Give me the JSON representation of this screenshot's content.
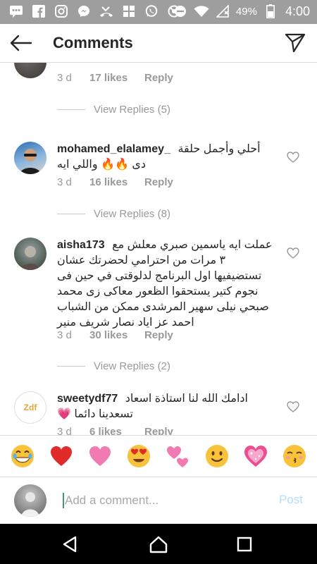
{
  "status_bar": {
    "battery_percent": "49%",
    "time": "4:00",
    "left_icons": [
      "messages-icon",
      "facebook-icon",
      "instagram-icon",
      "messenger-icon",
      "missed-call-icon",
      "gallery-icon",
      "whatsapp-icon",
      "blocked-icon"
    ],
    "right_icons": [
      "do-not-disturb-icon",
      "wifi-icon",
      "signal-icon",
      "battery-icon"
    ]
  },
  "header": {
    "title": "Comments"
  },
  "comments": [
    {
      "emoji_text": "👏🏻👏🏻👏🏻",
      "time": "3 d",
      "likes": "17 likes",
      "reply": "Reply",
      "view_replies": "View Replies (5)"
    },
    {
      "username": "mohamed_elalamey_",
      "text": "أحلي وأجمل حلقة دى 🔥🔥 واللي ايه",
      "time": "3 d",
      "likes": "16 likes",
      "reply": "Reply",
      "view_replies": "View Replies (8)"
    },
    {
      "username": "aisha173",
      "text": "عملت ايه ياسمين صبري معلش مع ٣ مرات من احترامي لحضرتك عشان تستضيفيها اول البرنامج لدلوقتى في حين فى نجوم كتير يستحقوا الظعور معاكى زى محمد صبحي نيلى سهير المرشدى ممكن من الشباب احمد عز اياد نصار شريف منير",
      "time": "3 d",
      "likes": "30 likes",
      "reply": "Reply",
      "view_replies": "View Replies (2)"
    },
    {
      "username": "sweetydf77",
      "avatar_text": "Zdf",
      "text": "ادامك الله لنا استاذة اسعاد تسعدينا دائما 💗",
      "time": "3 d",
      "likes": "6 likes",
      "reply": "Reply"
    }
  ],
  "emoji_bar": [
    "😂",
    "❤️",
    "💗",
    "😍",
    "💕",
    "🙂",
    "💖",
    "😚"
  ],
  "input": {
    "placeholder": "Add a comment...",
    "post_label": "Post"
  },
  "nav": [
    "back-icon",
    "home-icon",
    "recents-icon"
  ]
}
